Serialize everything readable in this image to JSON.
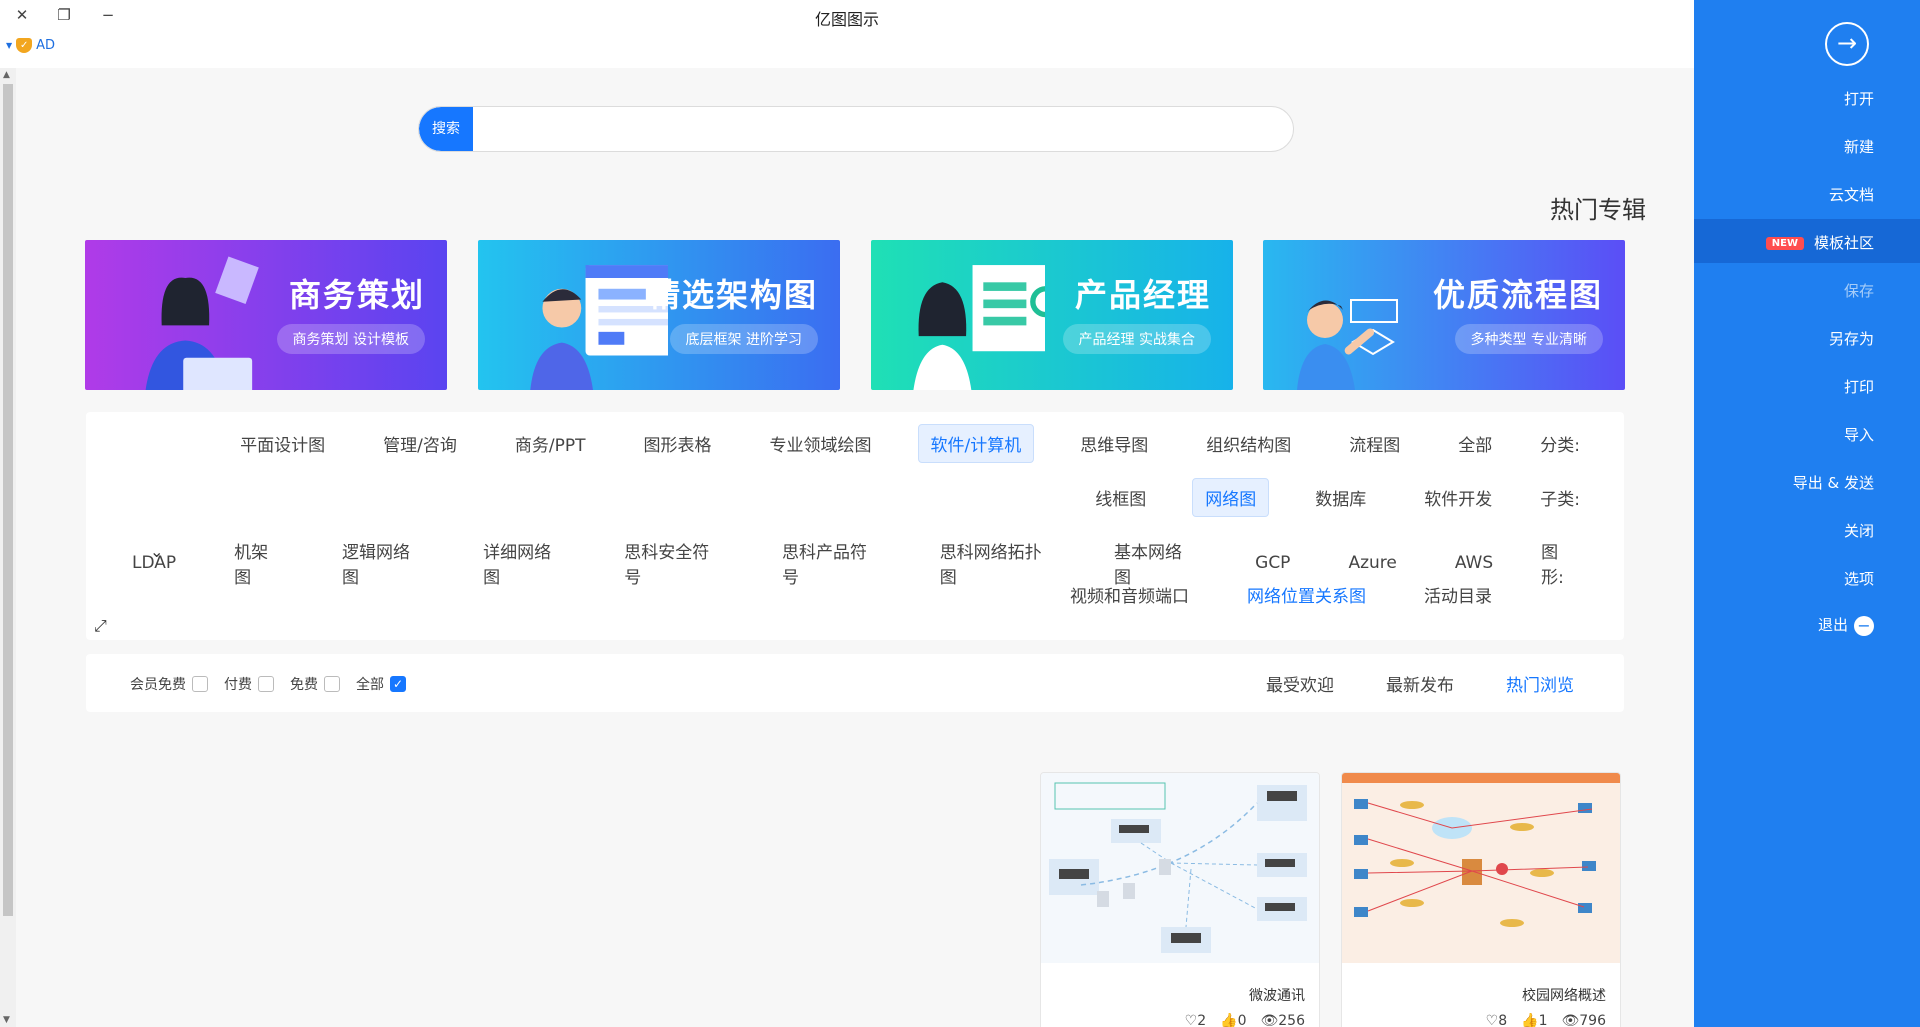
{
  "window": {
    "title": "亿图图示",
    "user_label": "AD"
  },
  "search": {
    "button_label": "搜索",
    "placeholder": ""
  },
  "hot": {
    "title": "热门专辑",
    "banners": [
      {
        "title": "优质流程图",
        "subtitle": "多种类型 专业清晰",
        "color": "#3d64f2"
      },
      {
        "title": "产品经理",
        "subtitle": "产品经理 实战集合",
        "color": "#19c6d8"
      },
      {
        "title": "精选架构图",
        "subtitle": "底层框架 进阶学习",
        "color": "#27b3e9"
      },
      {
        "title": "商务策划",
        "subtitle": "商务策划 设计模板",
        "color": "#8d3af0"
      }
    ]
  },
  "filters": {
    "category": {
      "label": "分类:",
      "options": [
        "全部",
        "流程图",
        "组织结构图",
        "思维导图",
        "软件/计算机",
        "专业领域绘图",
        "图形表格",
        "商务/PPT",
        "管理/咨询",
        "平面设计图"
      ],
      "selected": "软件/计算机"
    },
    "subcategory": {
      "label": "子类:",
      "options": [
        "软件开发",
        "数据库",
        "网络图",
        "线框图"
      ],
      "selected": "网络图"
    },
    "shapes": {
      "label": "图形:",
      "options_row1": [
        "AWS",
        "Azure",
        "GCP",
        "基本网络图",
        "思科网络拓扑图",
        "思科产品符号",
        "思科安全符号",
        "详细网络图",
        "逻辑网络图",
        "机架图",
        "LDAP"
      ],
      "options_row2": [
        "活动目录",
        "网络位置关系图",
        "视频和音频端口"
      ],
      "highlighted": "网络位置关系图"
    }
  },
  "sort": {
    "tabs": [
      "热门浏览",
      "最新发布",
      "最受欢迎"
    ],
    "selected": "热门浏览",
    "price_filters": [
      {
        "label": "全部",
        "checked": true
      },
      {
        "label": "免费",
        "checked": false
      },
      {
        "label": "付费",
        "checked": false
      },
      {
        "label": "会员免费",
        "checked": false
      }
    ]
  },
  "cards": [
    {
      "title": "校园网络概述",
      "views": "796",
      "likes": "1",
      "favorites": "8"
    },
    {
      "title": "微波通讯",
      "views": "256",
      "likes": "0",
      "favorites": "2"
    }
  ],
  "sidebar": {
    "items": [
      {
        "label": "打开"
      },
      {
        "label": "新建"
      },
      {
        "label": "云文档"
      },
      {
        "label": "模板社区",
        "tag": "NEW"
      },
      {
        "label": "保存"
      },
      {
        "label": "另存为"
      },
      {
        "label": "打印"
      },
      {
        "label": "导入"
      },
      {
        "label": "导出 & 发送"
      },
      {
        "label": "关闭"
      },
      {
        "label": "选项"
      },
      {
        "label": "退出"
      }
    ]
  },
  "colors": {
    "accent": "#1677ff",
    "sidebar": "#1f7ff0",
    "sidebar_active": "#1668d6"
  }
}
